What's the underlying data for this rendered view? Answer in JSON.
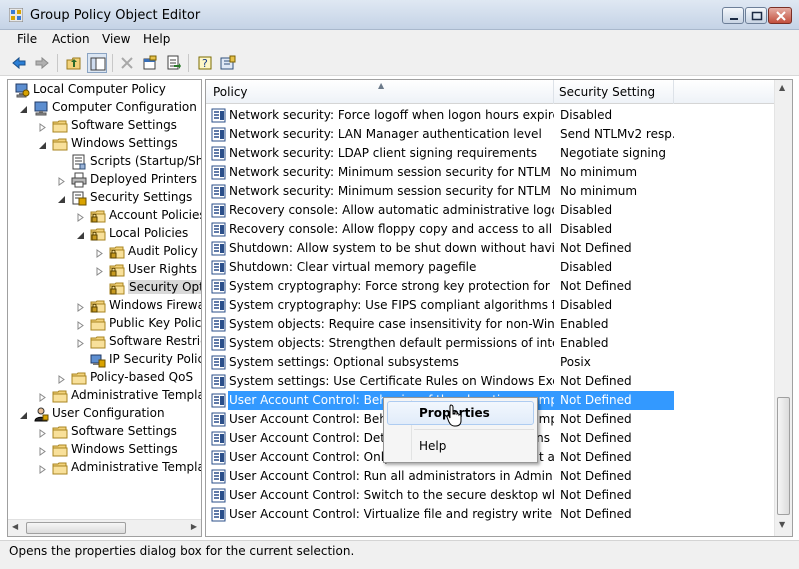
{
  "window": {
    "title": "Group Policy Object Editor"
  },
  "menubar": {
    "items": [
      "File",
      "Action",
      "View",
      "Help"
    ]
  },
  "toolbar": {
    "icons": [
      "back-arrow-icon",
      "forward-arrow-icon",
      "up-folder-icon",
      "show-hide-tree-icon",
      "delete-icon",
      "properties-icon",
      "export-list-icon",
      "help-icon",
      "help-topics-icon"
    ]
  },
  "tree": {
    "items": [
      {
        "label": "Local Computer Policy",
        "icon": "computer-policy-icon"
      },
      {
        "label": "Computer Configuration",
        "icon": "computer-icon"
      },
      {
        "label": "Software Settings",
        "icon": "folder-icon"
      },
      {
        "label": "Windows Settings",
        "icon": "folder-icon"
      },
      {
        "label": "Scripts (Startup/Shutdown)",
        "icon": "script-icon"
      },
      {
        "label": "Deployed Printers",
        "icon": "printer-icon"
      },
      {
        "label": "Security Settings",
        "icon": "security-settings-icon"
      },
      {
        "label": "Account Policies",
        "icon": "folder-lock-icon"
      },
      {
        "label": "Local Policies",
        "icon": "folder-lock-icon"
      },
      {
        "label": "Audit Policy",
        "icon": "folder-lock-icon"
      },
      {
        "label": "User Rights Assignment",
        "icon": "folder-lock-icon"
      },
      {
        "label": "Security Options",
        "icon": "folder-lock-icon"
      },
      {
        "label": "Windows Firewall",
        "icon": "folder-lock-icon"
      },
      {
        "label": "Public Key Policies",
        "icon": "folder-icon"
      },
      {
        "label": "Software Restriction",
        "icon": "folder-icon"
      },
      {
        "label": "IP Security Policies",
        "icon": "ip-security-icon"
      },
      {
        "label": "Policy-based QoS",
        "icon": "folder-icon"
      },
      {
        "label": "Administrative Templates",
        "icon": "folder-icon"
      },
      {
        "label": "User Configuration",
        "icon": "user-icon"
      },
      {
        "label": "Software Settings",
        "icon": "folder-icon"
      },
      {
        "label": "Windows Settings",
        "icon": "folder-icon"
      },
      {
        "label": "Administrative Templates",
        "icon": "folder-icon"
      }
    ]
  },
  "list": {
    "columns": {
      "policy": "Policy",
      "setting": "Security Setting"
    },
    "rows": [
      {
        "policy": "Network security: Force logoff when logon hours expire",
        "setting": "Disabled"
      },
      {
        "policy": "Network security: LAN Manager authentication level",
        "setting": "Send NTLMv2 resp..."
      },
      {
        "policy": "Network security: LDAP client signing requirements",
        "setting": "Negotiate signing"
      },
      {
        "policy": "Network security: Minimum session security for NTLM SSP ...",
        "setting": "No minimum"
      },
      {
        "policy": "Network security: Minimum session security for NTLM SSP ...",
        "setting": "No minimum"
      },
      {
        "policy": "Recovery console: Allow automatic administrative logon",
        "setting": "Disabled"
      },
      {
        "policy": "Recovery console: Allow floppy copy and access to all drive...",
        "setting": "Disabled"
      },
      {
        "policy": "Shutdown: Allow system to be shut down without having t...",
        "setting": "Not Defined"
      },
      {
        "policy": "Shutdown: Clear virtual memory pagefile",
        "setting": "Disabled"
      },
      {
        "policy": "System cryptography: Force strong key protection for user ...",
        "setting": "Not Defined"
      },
      {
        "policy": "System cryptography: Use FIPS compliant algorithms for en...",
        "setting": "Disabled"
      },
      {
        "policy": "System objects: Require case insensitivity for non-Windows...",
        "setting": "Enabled"
      },
      {
        "policy": "System objects: Strengthen default permissions of internal s...",
        "setting": "Enabled"
      },
      {
        "policy": "System settings: Optional subsystems",
        "setting": "Posix"
      },
      {
        "policy": "System settings: Use Certificate Rules on Windows Executab...",
        "setting": "Not Defined"
      },
      {
        "policy": "User Account Control: Behavior of the elevation prompt for...",
        "setting": "Not Defined"
      },
      {
        "policy": "User Account Control: Behavior of the elevation prompt for...",
        "setting": "Not Defined"
      },
      {
        "policy": "User Account Control: Detect application installations and...",
        "setting": "Not Defined"
      },
      {
        "policy": "User Account Control: Only elevate executables that are si...",
        "setting": "Not Defined"
      },
      {
        "policy": "User Account Control: Run all administrators in Admin App...",
        "setting": "Not Defined"
      },
      {
        "policy": "User Account Control: Switch to the secure desktop when p...",
        "setting": "Not Defined"
      },
      {
        "policy": "User Account Control: Virtualize file and registry write failur...",
        "setting": "Not Defined"
      }
    ],
    "selected_index": 15
  },
  "context_menu": {
    "items": [
      "Properties",
      "Help"
    ]
  },
  "statusbar": {
    "text": "Opens the properties dialog box for the current selection."
  },
  "colors": {
    "selection": "#3399ff",
    "titlebar": "#c5d3e6"
  }
}
